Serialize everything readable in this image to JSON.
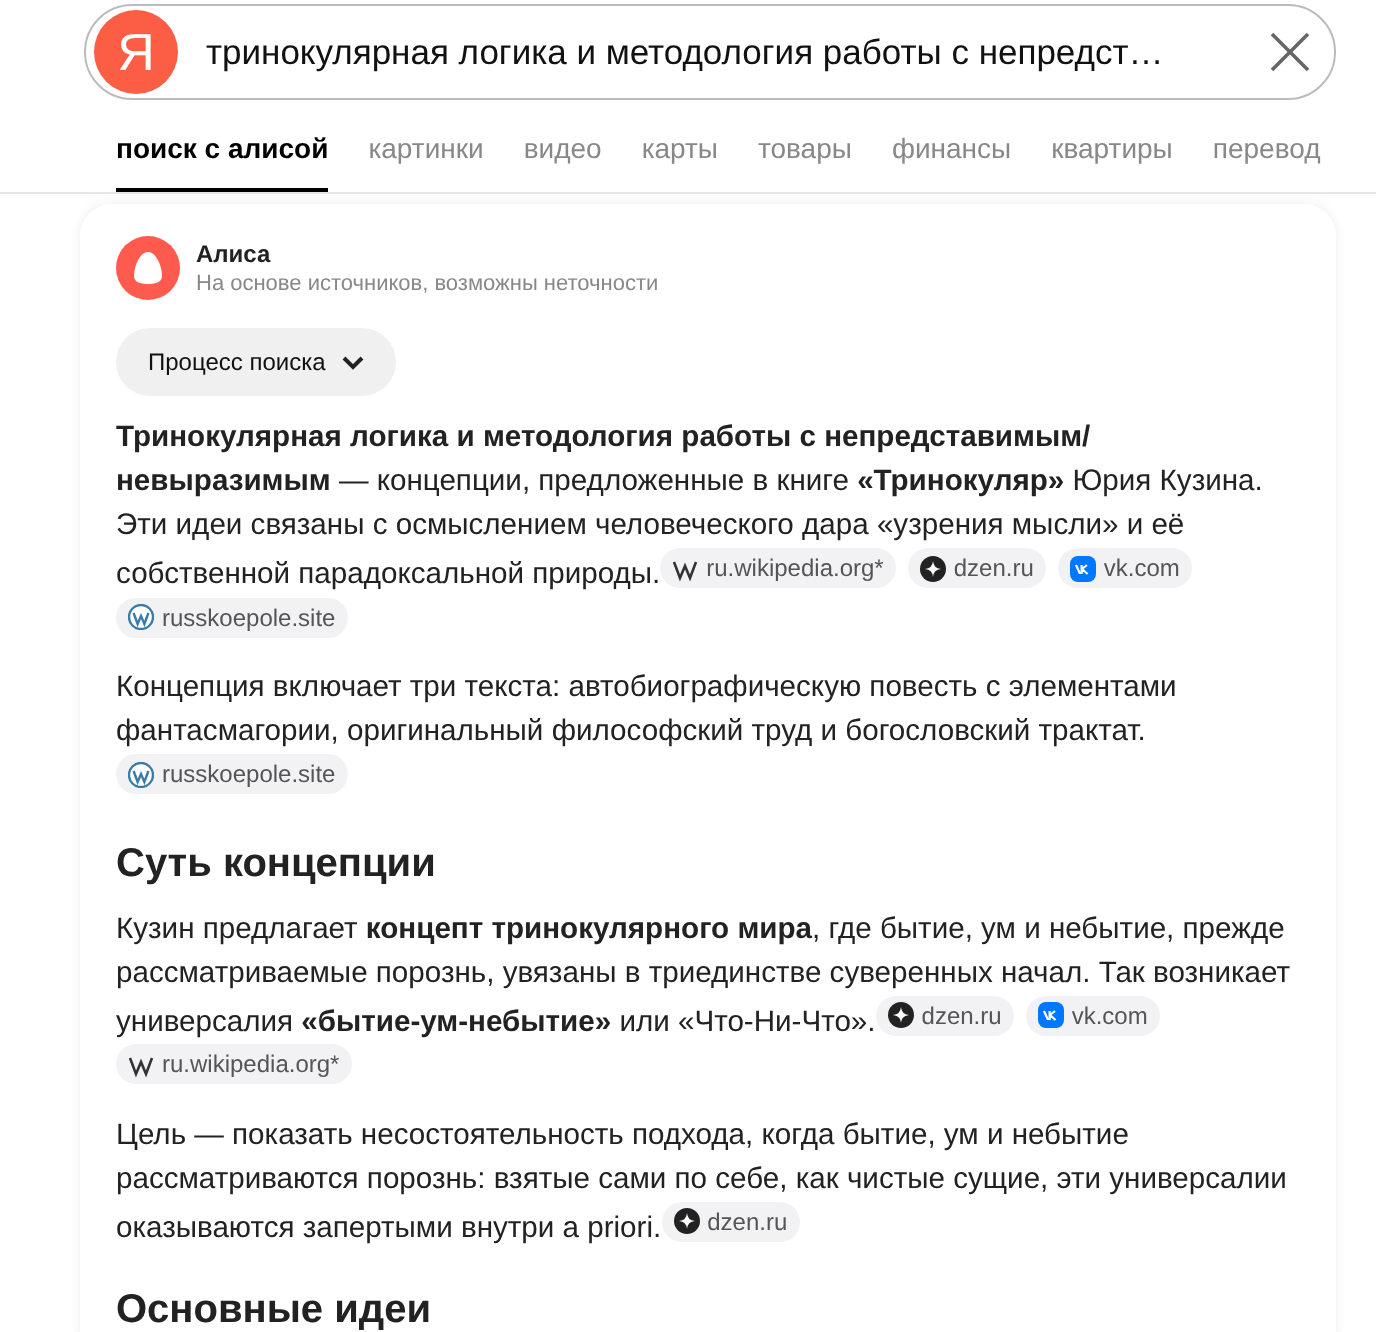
{
  "search": {
    "logo": "Я",
    "value": "тринокулярная логика и методология работы с непредст…"
  },
  "tabs": [
    {
      "label": "поиск с алисой",
      "selected": true
    },
    {
      "label": "картинки",
      "selected": false
    },
    {
      "label": "видео",
      "selected": false
    },
    {
      "label": "карты",
      "selected": false
    },
    {
      "label": "товары",
      "selected": false
    },
    {
      "label": "финансы",
      "selected": false
    },
    {
      "label": "квартиры",
      "selected": false
    },
    {
      "label": "перевод",
      "selected": false
    }
  ],
  "answer": {
    "author": "Алиса",
    "disclaimer": "На основе источников, возможны неточности",
    "process_button": "Процесс поиска",
    "blocks": [
      {
        "kind": "paragraph",
        "text": "**Тринокулярная логика и методология работы с непредставимым/невыразимым** — концепции, предложенные в книге **«Тринокуляр»** Юрия Кузина. Эти идеи связаны с осмыслением человеческого дара «узрения мысли» и её собственной парадоксальной природы.",
        "sources": [
          {
            "kind": "wiki",
            "label": "ru.wikipedia.org*"
          },
          {
            "kind": "dzen",
            "label": "dzen.ru"
          },
          {
            "kind": "vk",
            "label": "vk.com"
          },
          {
            "kind": "wp",
            "label": "russkoepole.site"
          }
        ]
      },
      {
        "kind": "paragraph",
        "text": "Концепция включает три текста: автобиографическую повесть с элементами фантасмагории, оригинальный философский труд и богословский трактат.",
        "sources": [
          {
            "kind": "wp",
            "label": "russkoepole.site"
          }
        ]
      },
      {
        "kind": "heading",
        "text": "Суть концепции"
      },
      {
        "kind": "paragraph",
        "text": "Кузин предлагает **концепт тринокулярного мира**, где бытие, ум и небытие, прежде рассматриваемые порознь, увязаны в триединстве суверенных начал. Так возникает универсалия **«бытие-ум-небытие»** или «Что-Ни-Что».",
        "sources": [
          {
            "kind": "dzen",
            "label": "dzen.ru"
          },
          {
            "kind": "vk",
            "label": "vk.com"
          },
          {
            "kind": "wiki",
            "label": "ru.wikipedia.org*"
          }
        ]
      },
      {
        "kind": "paragraph",
        "text": "Цель — показать несостоятельность подхода, когда бытие, ум и небытие рассматриваются порознь: взятые сами по себе, как чистые сущие, эти универсалии оказываются запертыми внутри a priori.",
        "sources": [
          {
            "kind": "dzen",
            "label": "dzen.ru"
          }
        ]
      },
      {
        "kind": "heading",
        "text": "Основные идеи"
      }
    ]
  }
}
